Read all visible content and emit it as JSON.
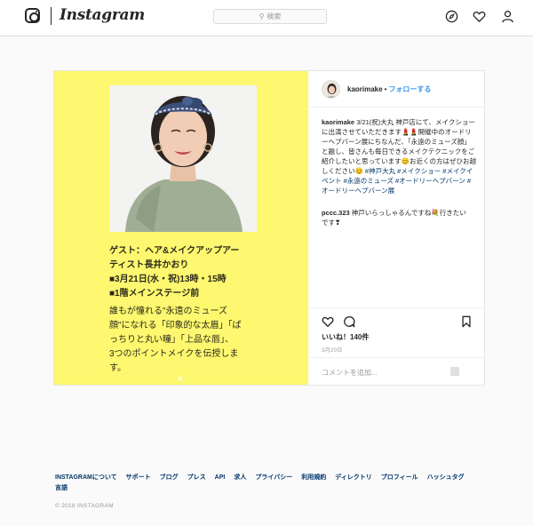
{
  "header": {
    "logo_text": "Instagram",
    "search_placeholder": "検索",
    "icons": [
      "instagram-glyph-icon",
      "compass-icon",
      "heart-icon",
      "profile-icon"
    ]
  },
  "post": {
    "media": {
      "bg_color": "#fdf86f",
      "photo": "woman-with-headscarf-photo",
      "guest_lines": [
        "ゲスト：ヘア&メイクアップアー",
        "ティスト長井かおり",
        "■3月21日(水・祝)13時・15時",
        "■1階メインステージ前"
      ],
      "desc_lines": [
        "誰もが憧れる\"永遠のミューズ",
        "顔\"になれる「印象的な太眉」「ぱ",
        "っちりと丸い瞳」「上品な唇」、",
        "3つのポイントメイクを伝授しま",
        "す。"
      ]
    },
    "header": {
      "username": "kaorimake",
      "separator": "•",
      "follow_label": "フォローする"
    },
    "caption": {
      "username": "kaorimake",
      "text": " 3/21(祝)大丸 神戸店にて、メイクショーに出演させていただきます💄💄開催中のオードリーヘプバーン展にちなんだ、「永遠のミューズ顔」と題し、皆さんも毎日できるメイクテクニックをご紹介したいと思っています😊お近くの方はぜひお越しください😊 ",
      "tags": "#神戸大丸 #メイクショー #メイクイベント #永遠のミューズ #オードリーヘプバーン #オードリーヘプバーン展"
    },
    "comment": {
      "username": "pccc.323",
      "text": " 神戸いらっしゃるんですね💐行きたいです❣"
    },
    "likes_label": "いいね！140件",
    "date": "3月20日",
    "comment_placeholder": "コメントを追加..."
  },
  "footer": {
    "links": [
      "INSTAGRAMについて",
      "サポート",
      "ブログ",
      "プレス",
      "API",
      "求人",
      "プライバシー",
      "利用規約",
      "ディレクトリ",
      "プロフィール",
      "ハッシュタグ",
      "言語"
    ],
    "copyright": "© 2018 INSTAGRAM"
  }
}
